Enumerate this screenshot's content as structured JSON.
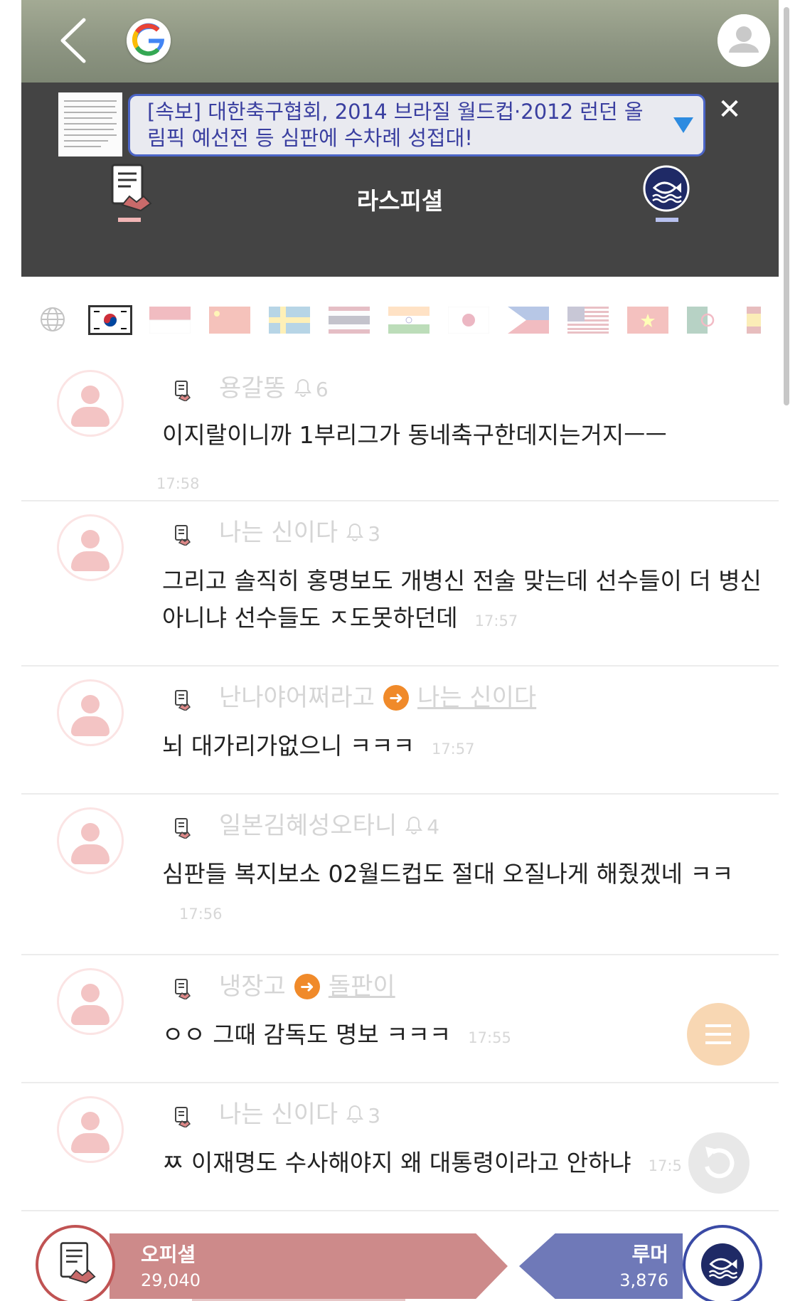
{
  "news": {
    "headline": "[속보] 대한축구협회, 2014 브라질 월드컵·2012 런던 올림픽 예선전 등 심판에 수차례 성접대!"
  },
  "header": {
    "channel_title": "라스피셜"
  },
  "flags": [
    "globe-icon",
    "kr",
    "id",
    "cn",
    "se",
    "th",
    "in",
    "jp",
    "ph",
    "us",
    "vn",
    "dz",
    "es"
  ],
  "comments": [
    {
      "user": "용갈똥",
      "likes": "6",
      "text": "이지랄이니까 1부리그가 동네축구한데지는거지ㅡㅡ",
      "time": "17:58"
    },
    {
      "user": "나는 신이다",
      "likes": "3",
      "text": "그리고 솔직히 홍명보도 개병신 전술 맞는데 선수들이 더 병신아니냐 선수들도 ㅈ도못하던데",
      "time": "17:57"
    },
    {
      "user": "난나야어쩌라고",
      "reply_to": "나는 신이다",
      "text": "뇌 대가리가없으니 ㅋㅋㅋ",
      "time": "17:57"
    },
    {
      "user": "일본김혜성오타니",
      "likes": "4",
      "text": "심판들 복지보소 02월드컵도 절대 오질나게 해줬겠네 ㅋㅋ",
      "time": "17:56"
    },
    {
      "user": "냉장고",
      "reply_to": "돌판이",
      "text": "ㅇㅇ 그때 감독도 명보 ㅋㅋㅋ",
      "time": "17:55"
    },
    {
      "user": "나는 신이다",
      "likes": "3",
      "text": "ㅉ 이재명도 수사해야지 왜 대통령이라고 안하냐",
      "time": "17:5"
    }
  ],
  "bottom": {
    "left_name": "오피셜",
    "left_count": "29,040",
    "right_name": "루머",
    "right_count": "3,876"
  },
  "colors": {
    "official": "#cd8a8a",
    "rumor": "#6f79b8",
    "news_border": "#4c65c7",
    "header_bg": "#444444"
  }
}
